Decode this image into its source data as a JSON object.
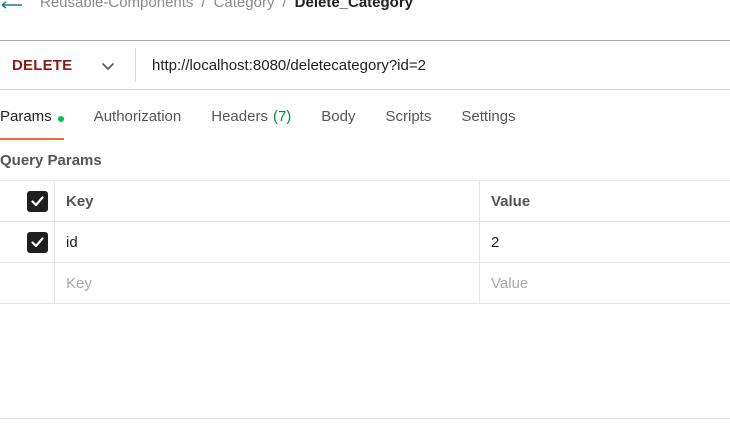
{
  "breadcrumb": {
    "icon": "http-icon",
    "items": [
      "Reusable-Components",
      "Category"
    ],
    "current": "Delete_Category",
    "separator": "/"
  },
  "request": {
    "method": "DELETE",
    "method_color": "#8e1a10",
    "url": "http://localhost:8080/deletecategory?id=2"
  },
  "tabs": [
    {
      "label": "Params",
      "active": true,
      "indicator": "green-dot"
    },
    {
      "label": "Authorization"
    },
    {
      "label": "Headers",
      "count": "(7)"
    },
    {
      "label": "Body"
    },
    {
      "label": "Scripts"
    },
    {
      "label": "Settings"
    }
  ],
  "query_params": {
    "title": "Query Params",
    "columns": {
      "key": "Key",
      "value": "Value"
    },
    "rows": [
      {
        "checked": true,
        "key": "id",
        "value": "2"
      }
    ],
    "new_row": {
      "key_placeholder": "Key",
      "value_placeholder": "Value"
    }
  },
  "colors": {
    "accent": "#f26b3a",
    "status_green": "#0cbb52",
    "count_green": "#0a8a3c"
  }
}
